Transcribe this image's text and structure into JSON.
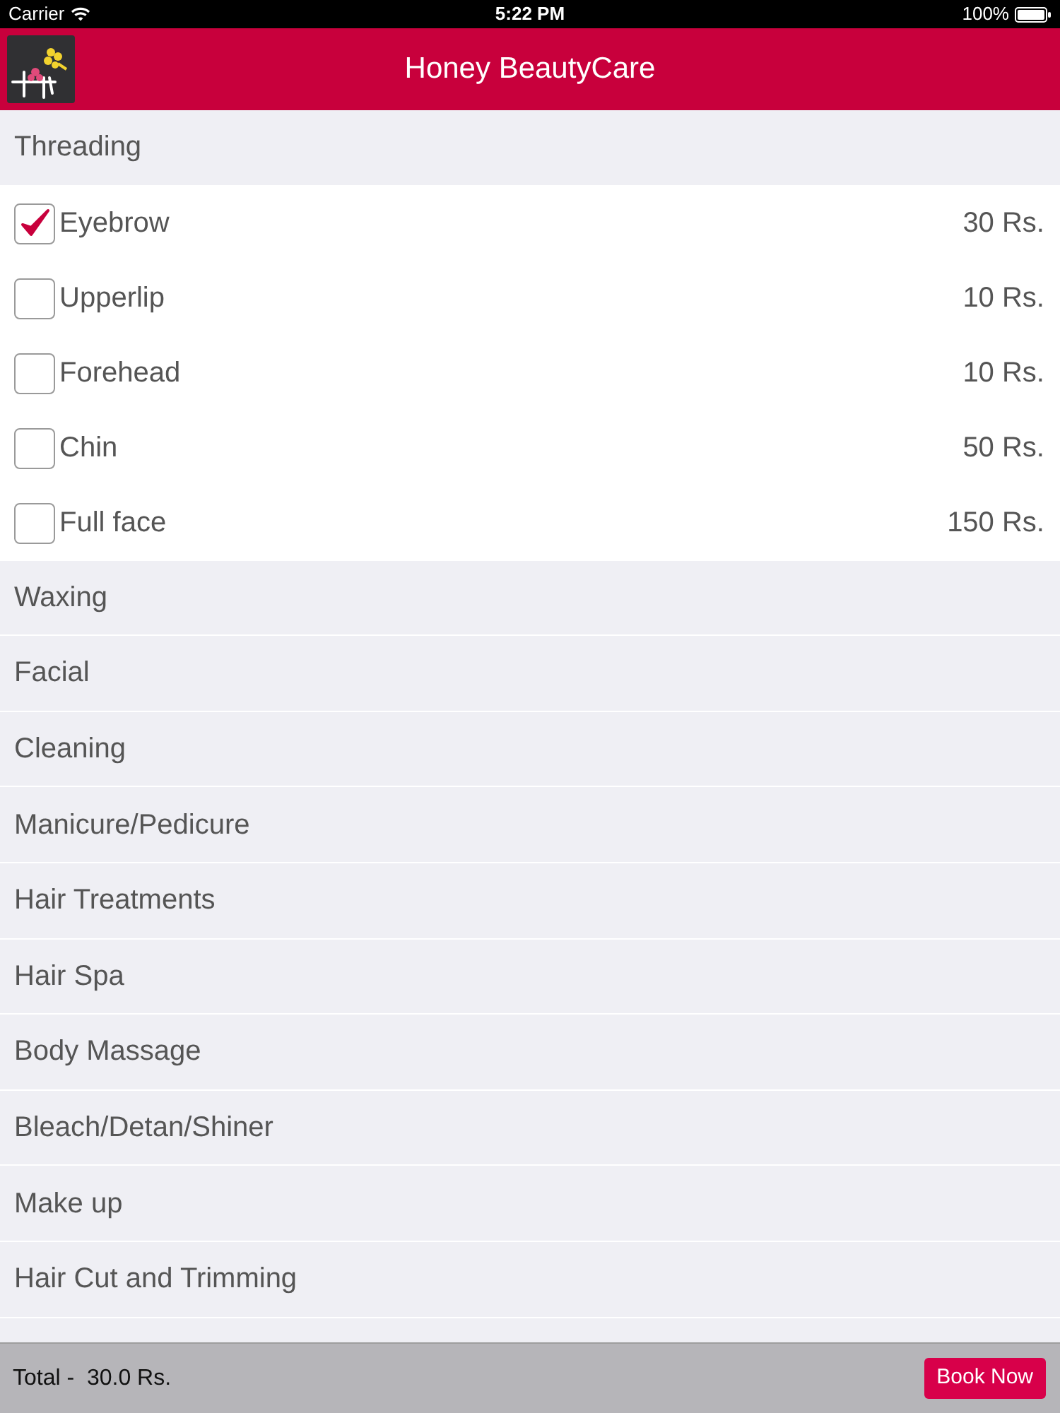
{
  "status_bar": {
    "carrier": "Carrier",
    "time": "5:22 PM",
    "battery": "100%"
  },
  "header": {
    "title": "Honey BeautyCare"
  },
  "categories": [
    {
      "name": "Threading",
      "services": [
        {
          "name": "Eyebrow",
          "price": "30 Rs.",
          "checked": true
        },
        {
          "name": "Upperlip",
          "price": "10 Rs.",
          "checked": false
        },
        {
          "name": "Forehead",
          "price": "10 Rs.",
          "checked": false
        },
        {
          "name": "Chin",
          "price": "50 Rs.",
          "checked": false
        },
        {
          "name": "Full face",
          "price": "150 Rs.",
          "checked": false
        }
      ]
    },
    {
      "name": "Waxing"
    },
    {
      "name": "Facial"
    },
    {
      "name": "Cleaning"
    },
    {
      "name": "Manicure/Pedicure"
    },
    {
      "name": "Hair Treatments"
    },
    {
      "name": "Hair Spa"
    },
    {
      "name": "Body Massage"
    },
    {
      "name": "Bleach/Detan/Shiner"
    },
    {
      "name": "Make up"
    },
    {
      "name": "Hair Cut and Trimming"
    }
  ],
  "footer": {
    "total": "Total -  30.0 Rs.",
    "button": "Book Now"
  }
}
